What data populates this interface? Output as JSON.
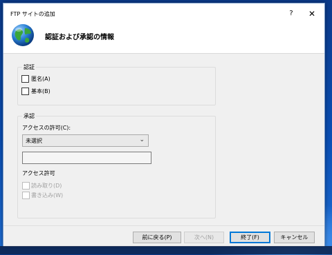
{
  "window": {
    "title": "FTP サイトの追加",
    "help_label": "?",
    "close_label": "✕"
  },
  "header": {
    "title": "認証および承認の情報"
  },
  "auth_group": {
    "title": "認証",
    "anonymous_label": "匿名(A)",
    "anonymous_checked": false,
    "basic_label": "基本(B)",
    "basic_checked": false
  },
  "authz_group": {
    "title": "承認",
    "access_label": "アクセスの許可(C):",
    "access_select_value": "未選択",
    "textbox_value": "",
    "permissions_title": "アクセス許可",
    "read_label": "読み取り(D)",
    "read_checked": false,
    "write_label": "書き込み(W)",
    "write_checked": false
  },
  "footer": {
    "back_label": "前に戻る(P)",
    "next_label": "次へ(N)",
    "finish_label": "終了(F)",
    "cancel_label": "キャンセル"
  },
  "icons": {
    "globe": "globe-icon",
    "close": "close-icon",
    "help": "help-icon",
    "dropdown": "chevron-down-icon"
  },
  "colors": {
    "window_bg": "#f0f0f0",
    "primary_border": "#0078d7",
    "disabled_text": "#a0a0a0"
  }
}
